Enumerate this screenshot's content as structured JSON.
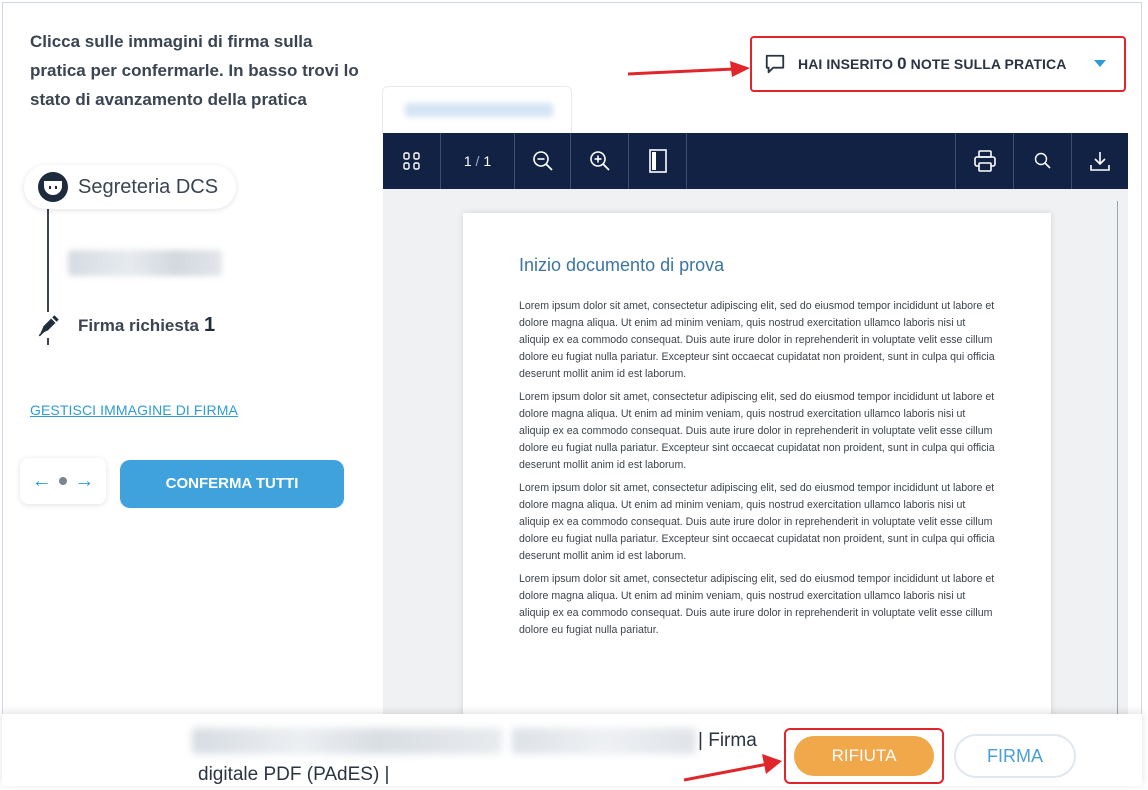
{
  "intro": {
    "text": "Clicca sulle immagini di firma sulla pratica per confermarle. In basso trovi lo stato di avanzamento della pratica"
  },
  "notes": {
    "prefix": "HAI INSERITO",
    "count": "0",
    "suffix": "NOTE SULLA PRATICA"
  },
  "timeline": {
    "node1_label": "Segreteria DCS",
    "firma_label": "Firma richiesta",
    "firma_count": "1"
  },
  "sidebar": {
    "manage_signature_link": "GESTISCI IMMAGINE DI FIRMA",
    "pager_prev": "←",
    "pager_next": "→",
    "confirm_all": "CONFERMA TUTTI"
  },
  "viewer": {
    "page_current": "1",
    "page_separator": "/",
    "page_total": "1",
    "document_title": "Inizio documento di prova",
    "paragraphs": [
      "Lorem ipsum dolor sit amet, consectetur adipiscing elit, sed do eiusmod tempor incididunt ut labore et dolore magna aliqua. Ut enim ad minim veniam, quis nostrud exercitation ullamco laboris nisi ut aliquip ex ea commodo consequat. Duis aute irure dolor in reprehenderit in voluptate velit esse cillum dolore eu fugiat nulla pariatur. Excepteur sint occaecat cupidatat non proident, sunt in culpa qui officia deserunt mollit anim id est laborum.",
      "Lorem ipsum dolor sit amet, consectetur adipiscing elit, sed do eiusmod tempor incididunt ut labore et dolore magna aliqua. Ut enim ad minim veniam, quis nostrud exercitation ullamco laboris nisi ut aliquip ex ea commodo consequat. Duis aute irure dolor in reprehenderit in voluptate velit esse cillum dolore eu fugiat nulla pariatur. Excepteur sint occaecat cupidatat non proident, sunt in culpa qui officia deserunt mollit anim id est laborum.",
      "Lorem ipsum dolor sit amet, consectetur adipiscing elit, sed do eiusmod tempor incididunt ut labore et dolore magna aliqua. Ut enim ad minim veniam, quis nostrud exercitation ullamco laboris nisi ut aliquip ex ea commodo consequat. Duis aute irure dolor in reprehenderit in voluptate velit esse cillum dolore eu fugiat nulla pariatur. Excepteur sint occaecat cupidatat non proident, sunt in culpa qui officia deserunt mollit anim id est laborum.",
      "Lorem ipsum dolor sit amet, consectetur adipiscing elit, sed do eiusmod tempor incididunt ut labore et dolore magna aliqua. Ut enim ad minim veniam, quis nostrud exercitation ullamco laboris nisi ut aliquip ex ea commodo consequat. Duis aute irure dolor in reprehenderit in voluptate velit esse cillum dolore eu fugiat nulla pariatur."
    ]
  },
  "footer": {
    "firma_type_part1": "| Firma",
    "firma_type_part2": "digitale PDF (PAdES) |",
    "reject": "RIFIUTA",
    "sign": "FIRMA"
  },
  "colors": {
    "accent": "#3fa2dc",
    "toolbar": "#112244",
    "reject": "#f0a84a",
    "annotation": "#e0262a"
  }
}
